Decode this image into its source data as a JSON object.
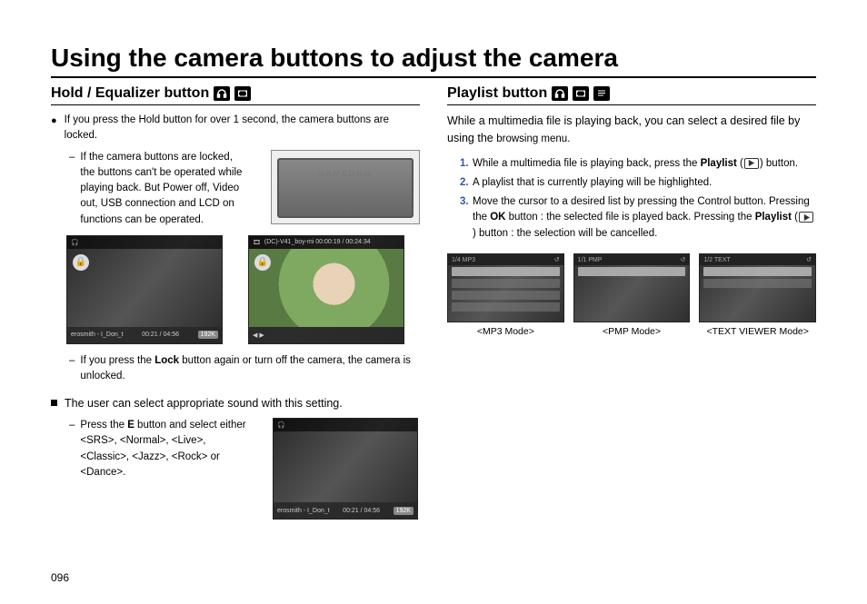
{
  "page_title": "Using the camera buttons to adjust the camera",
  "left": {
    "heading": "Hold / Equalizer button",
    "bullet1": "If you press the Hold button for over 1 second, the camera buttons are locked.",
    "dash1": "If the camera buttons are locked, the buttons can't be operated while playing back. But Power off, Video out, USB connection and LCD on functions can be operated.",
    "camera_brand": "SAMSUNG",
    "player_track": "erosmith - I_Don_t",
    "player_time": "00:21 / 04:56",
    "player_bitrate": "192K",
    "video_topbar": "(DC)-V41_boy-mi    00:00:19 / 00:24:34",
    "dash2_prefix": "If you press the ",
    "dash2_bold": "Lock",
    "dash2_suffix": " button again or turn off the camera, the camera is unlocked.",
    "square_text": "The user can select appropriate sound with this setting.",
    "eq_prefix": "Press the ",
    "eq_bold": "E",
    "eq_suffix": " button and select either <SRS>, <Normal>, <Live>, <Classic>, <Jazz>, <Rock> or <Dance>."
  },
  "right": {
    "heading": "Playlist button",
    "lead": "While a multimedia file is playing back, you can select a desired file by using the ",
    "lead_suffix": "browsing menu.",
    "step1_a": "While a multimedia file is playing back, press the ",
    "step1_bold": "Playlist",
    "step1_b": " (",
    "step1_c": ") button.",
    "step2": "A playlist that is currently playing will be highlighted.",
    "step3_a": "Move the cursor to a desired list by pressing the Control button. Pressing the ",
    "step3_bold1": "OK",
    "step3_b": " button : the selected file is played back. Pressing the ",
    "step3_bold2": "Playlist",
    "step3_c": " (",
    "step3_d": ") button : the selection will be cancelled.",
    "mode1_tb": "1/4   MP3",
    "mode2_tb": "1/1   PMP",
    "mode3_tb": "1/2   TEXT",
    "caption1": "<MP3 Mode>",
    "caption2": "<PMP Mode>",
    "caption3": "<TEXT VIEWER Mode>"
  },
  "page_number": "096"
}
